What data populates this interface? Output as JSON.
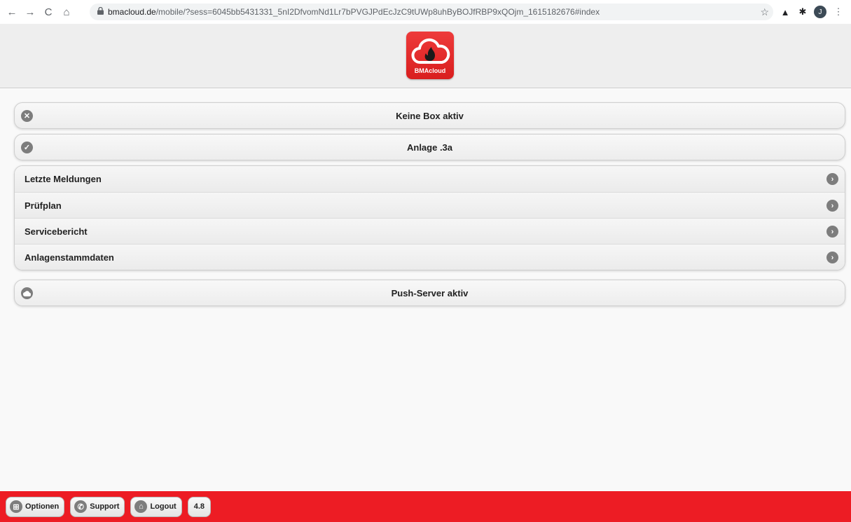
{
  "browser": {
    "back_icon": "←",
    "forward_icon": "→",
    "reload_icon": "C",
    "home_icon": "⌂",
    "url_host": "bmacloud.de",
    "url_path": "/mobile/?sess=6045bb5431331_5nI2DfvomNd1Lr7bPVGJPdEcJzC9tUWp8uhByBOJfRBP9xQOjm_1615182676#index",
    "star_icon": "☆",
    "ext1_icon": "▲",
    "ext2_icon": "✱",
    "avatar_letter": "J",
    "menu_icon": "⋮"
  },
  "header": {
    "logo_text": "BMAcloud",
    "logo_color": "#e82b2b"
  },
  "status": {
    "box": {
      "label": "Keine Box aktiv",
      "icon": "close-circle-icon",
      "glyph": "✕"
    },
    "anlage": {
      "label": "Anlage .3a",
      "icon": "check-circle-icon",
      "glyph": "✓"
    }
  },
  "menu": {
    "items": [
      {
        "label": "Letzte Meldungen"
      },
      {
        "label": "Prüfplan"
      },
      {
        "label": "Servicebericht"
      },
      {
        "label": "Anlagenstammdaten"
      }
    ],
    "chevron_glyph": "›"
  },
  "push": {
    "label": "Push-Server aktiv",
    "icon": "cloud-icon",
    "glyph": "●"
  },
  "footer": {
    "background": "#ed1c24",
    "options_label": "Optionen",
    "options_glyph": "⊞",
    "support_label": "Support",
    "support_glyph": "✆",
    "logout_label": "Logout",
    "logout_glyph": "⌂",
    "version": "4.8"
  }
}
